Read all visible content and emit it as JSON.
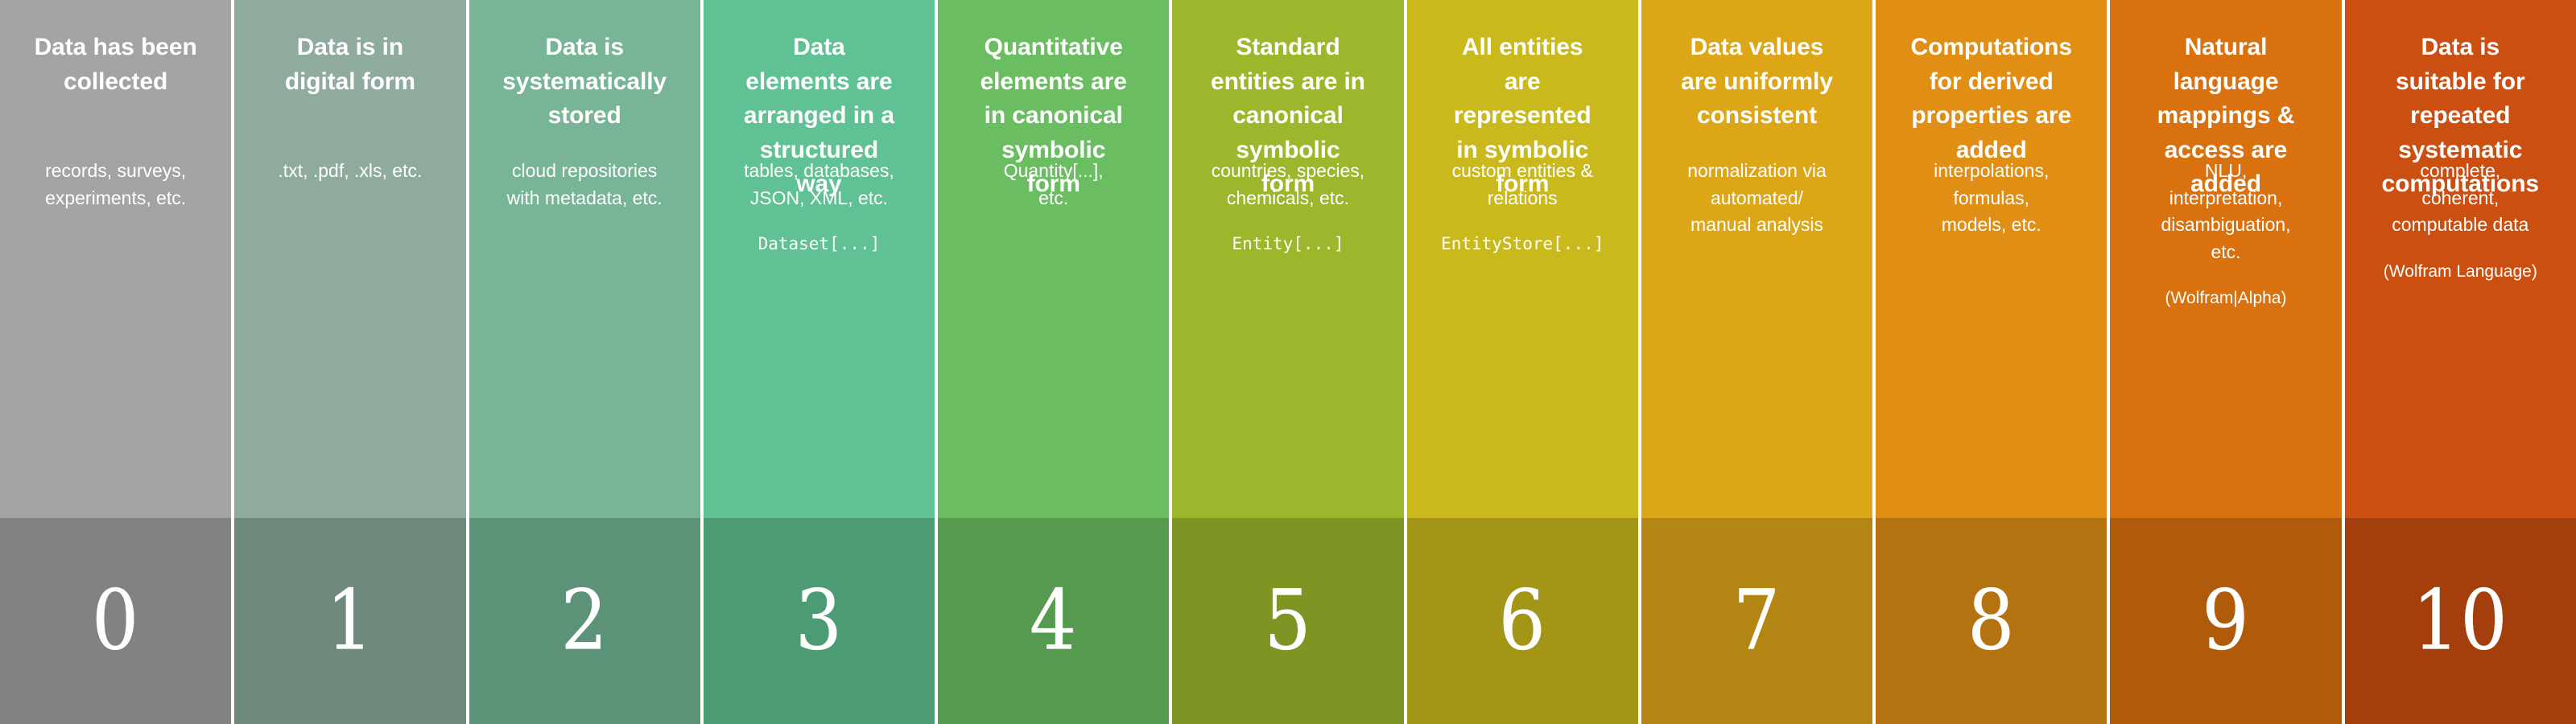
{
  "figure": {
    "kind": "computability-scale",
    "levels_count": 11,
    "text_color": "#ffffff",
    "background": "#ffffff"
  },
  "columns": [
    {
      "number": "0",
      "header": "Data has been\ncollected",
      "sub": "records, surveys,\nexperiments, etc.",
      "code": "",
      "note": "",
      "color_top": "#a3a3a3",
      "color_bottom": "#828282"
    },
    {
      "number": "1",
      "header": "Data is in\ndigital form",
      "sub": ".txt, .pdf, .xls, etc.",
      "code": "",
      "note": "",
      "color_top": "#8eab9e",
      "color_bottom": "#6f8a7d"
    },
    {
      "number": "2",
      "header": "Data is\nsystematically\nstored",
      "sub": "cloud repositories\nwith metadata, etc.",
      "code": "",
      "note": "",
      "color_top": "#78b496",
      "color_bottom": "#5c9378"
    },
    {
      "number": "3",
      "header": "Data\nelements are\narranged in a\nstructured\nway",
      "sub": "tables, databases,\nJSON, XML, etc.",
      "code": "Dataset[...]",
      "note": "",
      "color_top": "#60c194",
      "color_bottom": "#4c9b74"
    },
    {
      "number": "4",
      "header": "Quantitative\nelements are\nin canonical\nsymbolic\nform",
      "sub": "Quantity[...],\netc.",
      "code": "",
      "note": "",
      "color_top": "#6bbd62",
      "color_bottom": "#569a4f"
    },
    {
      "number": "5",
      "header": "Standard\nentities are in\ncanonical\nsymbolic\nform",
      "sub": "countries, species,\nchemicals, etc.",
      "code": "Entity[...]",
      "note": "",
      "color_top": "#9cb72c",
      "color_bottom": "#7e9423"
    },
    {
      "number": "6",
      "header": "All entities\nare\nrepresented\nin symbolic\nform",
      "sub": "custom entities &\nrelations",
      "code": "EntityStore[...]",
      "note": "",
      "color_top": "#c9b91c",
      "color_bottom": "#a39516"
    },
    {
      "number": "7",
      "header": "Data values\nare uniformly\nconsistent",
      "sub": "normalization via\nautomated/\nmanual analysis",
      "code": "",
      "note": "",
      "color_top": "#dda616",
      "color_bottom": "#b38512"
    },
    {
      "number": "8",
      "header": "Computations\nfor derived\nproperties are\nadded",
      "sub": "interpolations,\nformulas,\nmodels, etc.",
      "code": "",
      "note": "",
      "color_top": "#e08e14",
      "color_bottom": "#b57210"
    },
    {
      "number": "9",
      "header": "Natural\nlanguage\nmappings &\naccess are\nadded",
      "sub": "NLU,\ninterpretation,\ndisambiguation,\netc.",
      "code": "",
      "note": "(Wolfram|Alpha)",
      "color_top": "#da710f",
      "color_bottom": "#b05a0b"
    },
    {
      "number": "10",
      "header": "Data is\nsuitable for\nrepeated\nsystematic\ncomputations",
      "sub": "complete,\ncoherent,\ncomputable data",
      "code": "",
      "note": "(Wolfram Language)",
      "color_top": "#cc4f12",
      "color_bottom": "#a43e0d"
    }
  ]
}
